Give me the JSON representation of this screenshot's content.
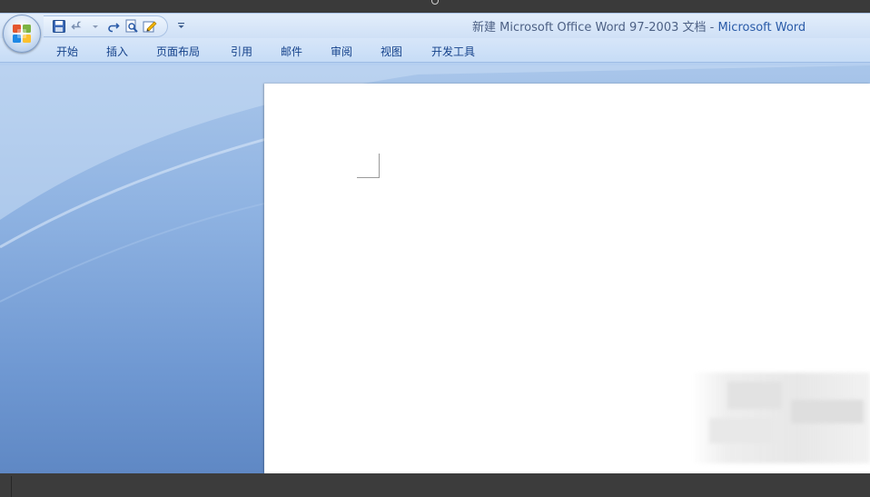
{
  "window": {
    "title_doc": "新建 Microsoft Office Word 97-2003 文档",
    "title_sep": " - ",
    "title_app": "Microsoft Word"
  },
  "ribbon": {
    "tabs": [
      {
        "label": "开始"
      },
      {
        "label": "插入"
      },
      {
        "label": "页面布局"
      },
      {
        "label": "引用"
      },
      {
        "label": "邮件"
      },
      {
        "label": "审阅"
      },
      {
        "label": "视图"
      },
      {
        "label": "开发工具"
      }
    ]
  },
  "quick_access": {
    "icons": [
      "save-icon",
      "undo-icon",
      "redo-icon",
      "print-preview-icon",
      "edit-icon",
      "customize-dropdown-icon"
    ]
  },
  "colors": {
    "tab_text": "#15428b",
    "title_text": "#4d6185",
    "title_app": "#2a5ba8",
    "workspace": "#8fb3e2"
  }
}
